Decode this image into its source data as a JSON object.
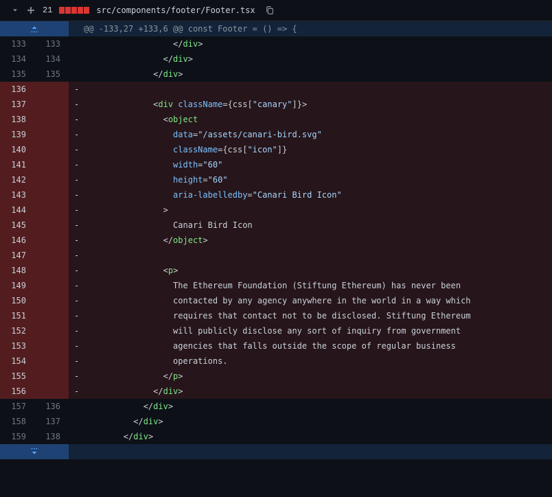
{
  "header": {
    "change_count": "21",
    "file_path": "src/components/footer/Footer.tsx"
  },
  "hunk": {
    "text": "@@ -133,27 +133,6 @@ const Footer = () => {"
  },
  "lines": [
    {
      "old": "133",
      "new": "133",
      "type": "ctx",
      "indent": "                  ",
      "kind": "close",
      "tag": "div"
    },
    {
      "old": "134",
      "new": "134",
      "type": "ctx",
      "indent": "                ",
      "kind": "close",
      "tag": "div"
    },
    {
      "old": "135",
      "new": "135",
      "type": "ctx",
      "indent": "              ",
      "kind": "close",
      "tag": "div"
    },
    {
      "old": "136",
      "new": "",
      "type": "del",
      "indent": "",
      "kind": "blank"
    },
    {
      "old": "137",
      "new": "",
      "type": "del",
      "indent": "              ",
      "kind": "open_expr",
      "tag": "div",
      "attr": "className",
      "expr_pre": "{css[",
      "expr_str": "\"canary\"",
      "expr_post": "]}"
    },
    {
      "old": "138",
      "new": "",
      "type": "del",
      "indent": "                ",
      "kind": "open_bare",
      "tag": "object"
    },
    {
      "old": "139",
      "new": "",
      "type": "del",
      "indent": "                  ",
      "kind": "attr_str",
      "attr": "data",
      "val": "\"/assets/canari-bird.svg\""
    },
    {
      "old": "140",
      "new": "",
      "type": "del",
      "indent": "                  ",
      "kind": "attr_expr",
      "attr": "className",
      "expr_pre": "{css[",
      "expr_str": "\"icon\"",
      "expr_post": "]}"
    },
    {
      "old": "141",
      "new": "",
      "type": "del",
      "indent": "                  ",
      "kind": "attr_str",
      "attr": "width",
      "val": "\"60\""
    },
    {
      "old": "142",
      "new": "",
      "type": "del",
      "indent": "                  ",
      "kind": "attr_str",
      "attr": "height",
      "val": "\"60\""
    },
    {
      "old": "143",
      "new": "",
      "type": "del",
      "indent": "                  ",
      "kind": "attr_str",
      "attr": "aria-labelledby",
      "val": "\"Canari Bird Icon\""
    },
    {
      "old": "144",
      "new": "",
      "type": "del",
      "indent": "                ",
      "kind": "gt"
    },
    {
      "old": "145",
      "new": "",
      "type": "del",
      "indent": "                  ",
      "kind": "text",
      "text": "Canari Bird Icon"
    },
    {
      "old": "146",
      "new": "",
      "type": "del",
      "indent": "                ",
      "kind": "close",
      "tag": "object"
    },
    {
      "old": "147",
      "new": "",
      "type": "del",
      "indent": "",
      "kind": "blank"
    },
    {
      "old": "148",
      "new": "",
      "type": "del",
      "indent": "                ",
      "kind": "open_simple",
      "tag": "p"
    },
    {
      "old": "149",
      "new": "",
      "type": "del",
      "indent": "                  ",
      "kind": "text",
      "text": "The Ethereum Foundation (Stiftung Ethereum) has never been"
    },
    {
      "old": "150",
      "new": "",
      "type": "del",
      "indent": "                  ",
      "kind": "text",
      "text": "contacted by any agency anywhere in the world in a way which"
    },
    {
      "old": "151",
      "new": "",
      "type": "del",
      "indent": "                  ",
      "kind": "text",
      "text": "requires that contact not to be disclosed. Stiftung Ethereum"
    },
    {
      "old": "152",
      "new": "",
      "type": "del",
      "indent": "                  ",
      "kind": "text",
      "text": "will publicly disclose any sort of inquiry from government"
    },
    {
      "old": "153",
      "new": "",
      "type": "del",
      "indent": "                  ",
      "kind": "text",
      "text": "agencies that falls outside the scope of regular business"
    },
    {
      "old": "154",
      "new": "",
      "type": "del",
      "indent": "                  ",
      "kind": "text",
      "text": "operations."
    },
    {
      "old": "155",
      "new": "",
      "type": "del",
      "indent": "                ",
      "kind": "close",
      "tag": "p"
    },
    {
      "old": "156",
      "new": "",
      "type": "del",
      "indent": "              ",
      "kind": "close",
      "tag": "div"
    },
    {
      "old": "157",
      "new": "136",
      "type": "ctx",
      "indent": "            ",
      "kind": "close",
      "tag": "div"
    },
    {
      "old": "158",
      "new": "137",
      "type": "ctx",
      "indent": "          ",
      "kind": "close",
      "tag": "div"
    },
    {
      "old": "159",
      "new": "138",
      "type": "ctx",
      "indent": "        ",
      "kind": "close",
      "tag": "div"
    }
  ]
}
